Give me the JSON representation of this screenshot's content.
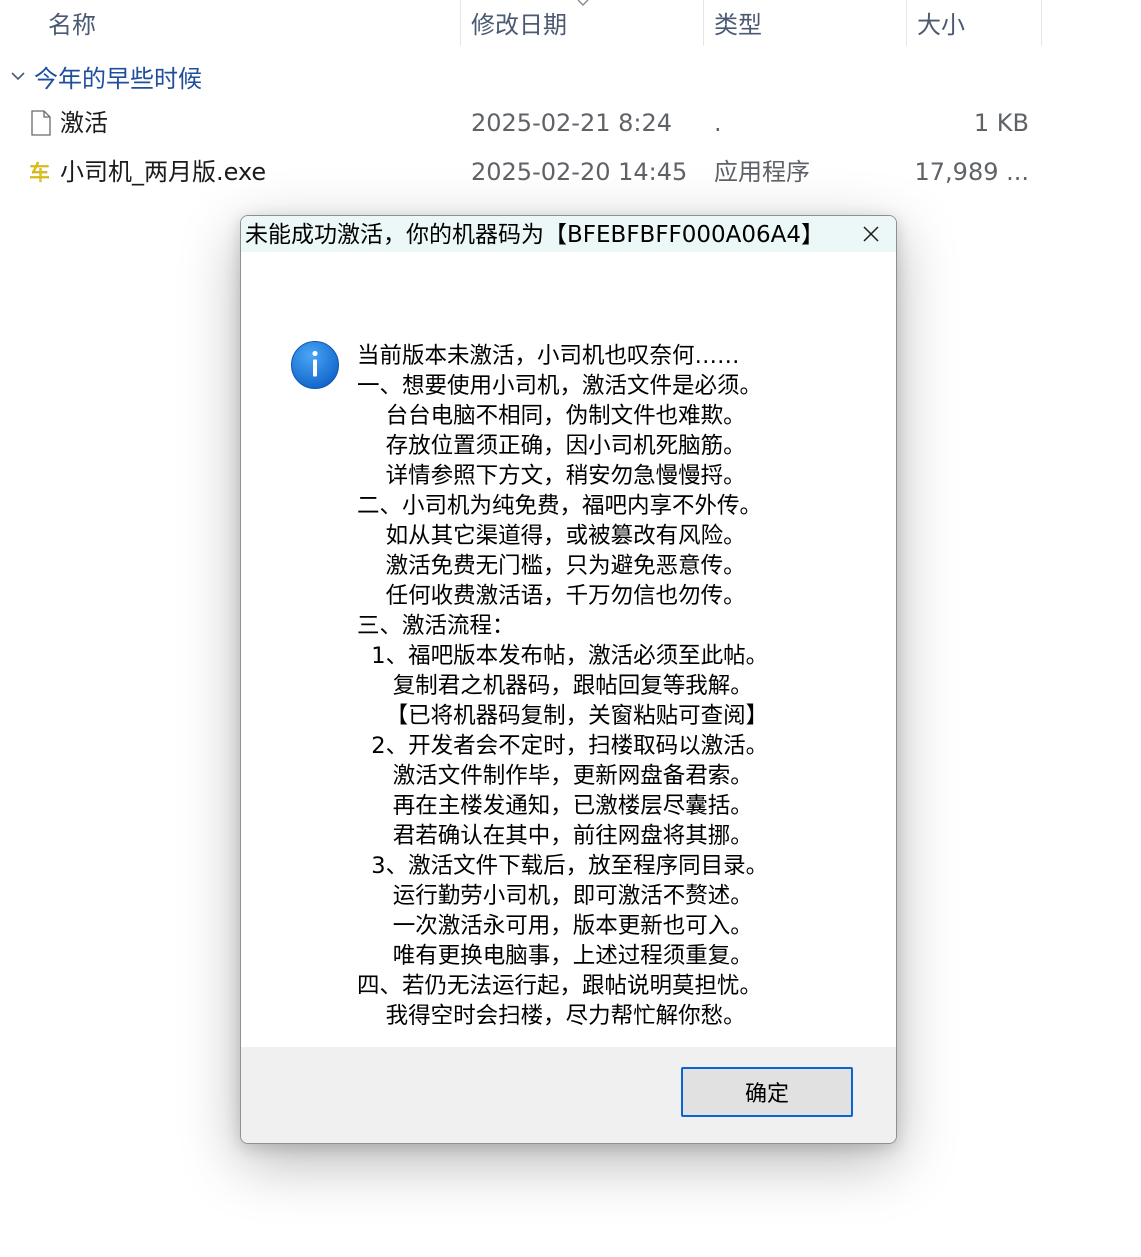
{
  "explorer": {
    "columns": {
      "name": "名称",
      "date_modified": "修改日期",
      "type": "类型",
      "size": "大小"
    },
    "group": {
      "label": "今年的早些时候"
    },
    "files": [
      {
        "name": "激活",
        "date": "2025-02-21 8:24",
        "type": ".",
        "size": "1 KB",
        "icon": "blank-file-icon"
      },
      {
        "name": "小司机_两月版.exe",
        "date": "2025-02-20 14:45",
        "type": "应用程序",
        "size": "17,989 ...",
        "icon": "car-app-icon"
      }
    ]
  },
  "dialog": {
    "title": "未能成功激活，你的机器码为【BFEBFBFF000A06A4】",
    "icon": "info-icon",
    "message_lines": [
      "当前版本未激活，小司机也叹奈何……",
      "一、想要使用小司机，激活文件是必须。",
      "    台台电脑不相同，伪制文件也难欺。",
      "    存放位置须正确，因小司机死脑筋。",
      "    详情参照下方文，稍安勿急慢慢捋。",
      "二、小司机为纯免费，福吧内享不外传。",
      "    如从其它渠道得，或被篡改有风险。",
      "    激活免费无门槛，只为避免恶意传。",
      "    任何收费激活语，千万勿信也勿传。",
      "三、激活流程：",
      "  1、福吧版本发布帖，激活必须至此帖。",
      "     复制君之机器码，跟帖回复等我解。",
      "    【已将机器码复制，关窗粘贴可查阅】",
      "  2、开发者会不定时，扫楼取码以激活。",
      "     激活文件制作毕，更新网盘备君索。",
      "     再在主楼发通知，已激楼层尽囊括。",
      "     君若确认在其中，前往网盘将其挪。",
      "  3、激活文件下载后，放至程序同目录。",
      "     运行勤劳小司机，即可激活不赘述。",
      "     一次激活永可用，版本更新也可入。",
      "     唯有更换电脑事，上述过程须重复。",
      "四、若仍无法运行起，跟帖说明莫担忧。",
      "    我得空时会扫楼，尽力帮忙解你愁。"
    ],
    "ok_label": "确定"
  },
  "colors": {
    "header_text": "#4b5a72",
    "group_text": "#1f4e9c",
    "titlebar_bg": "#ecf7f8",
    "footer_bg": "#f0f0f0",
    "button_border": "#0a64d4",
    "info_icon": "#1a73d6"
  }
}
